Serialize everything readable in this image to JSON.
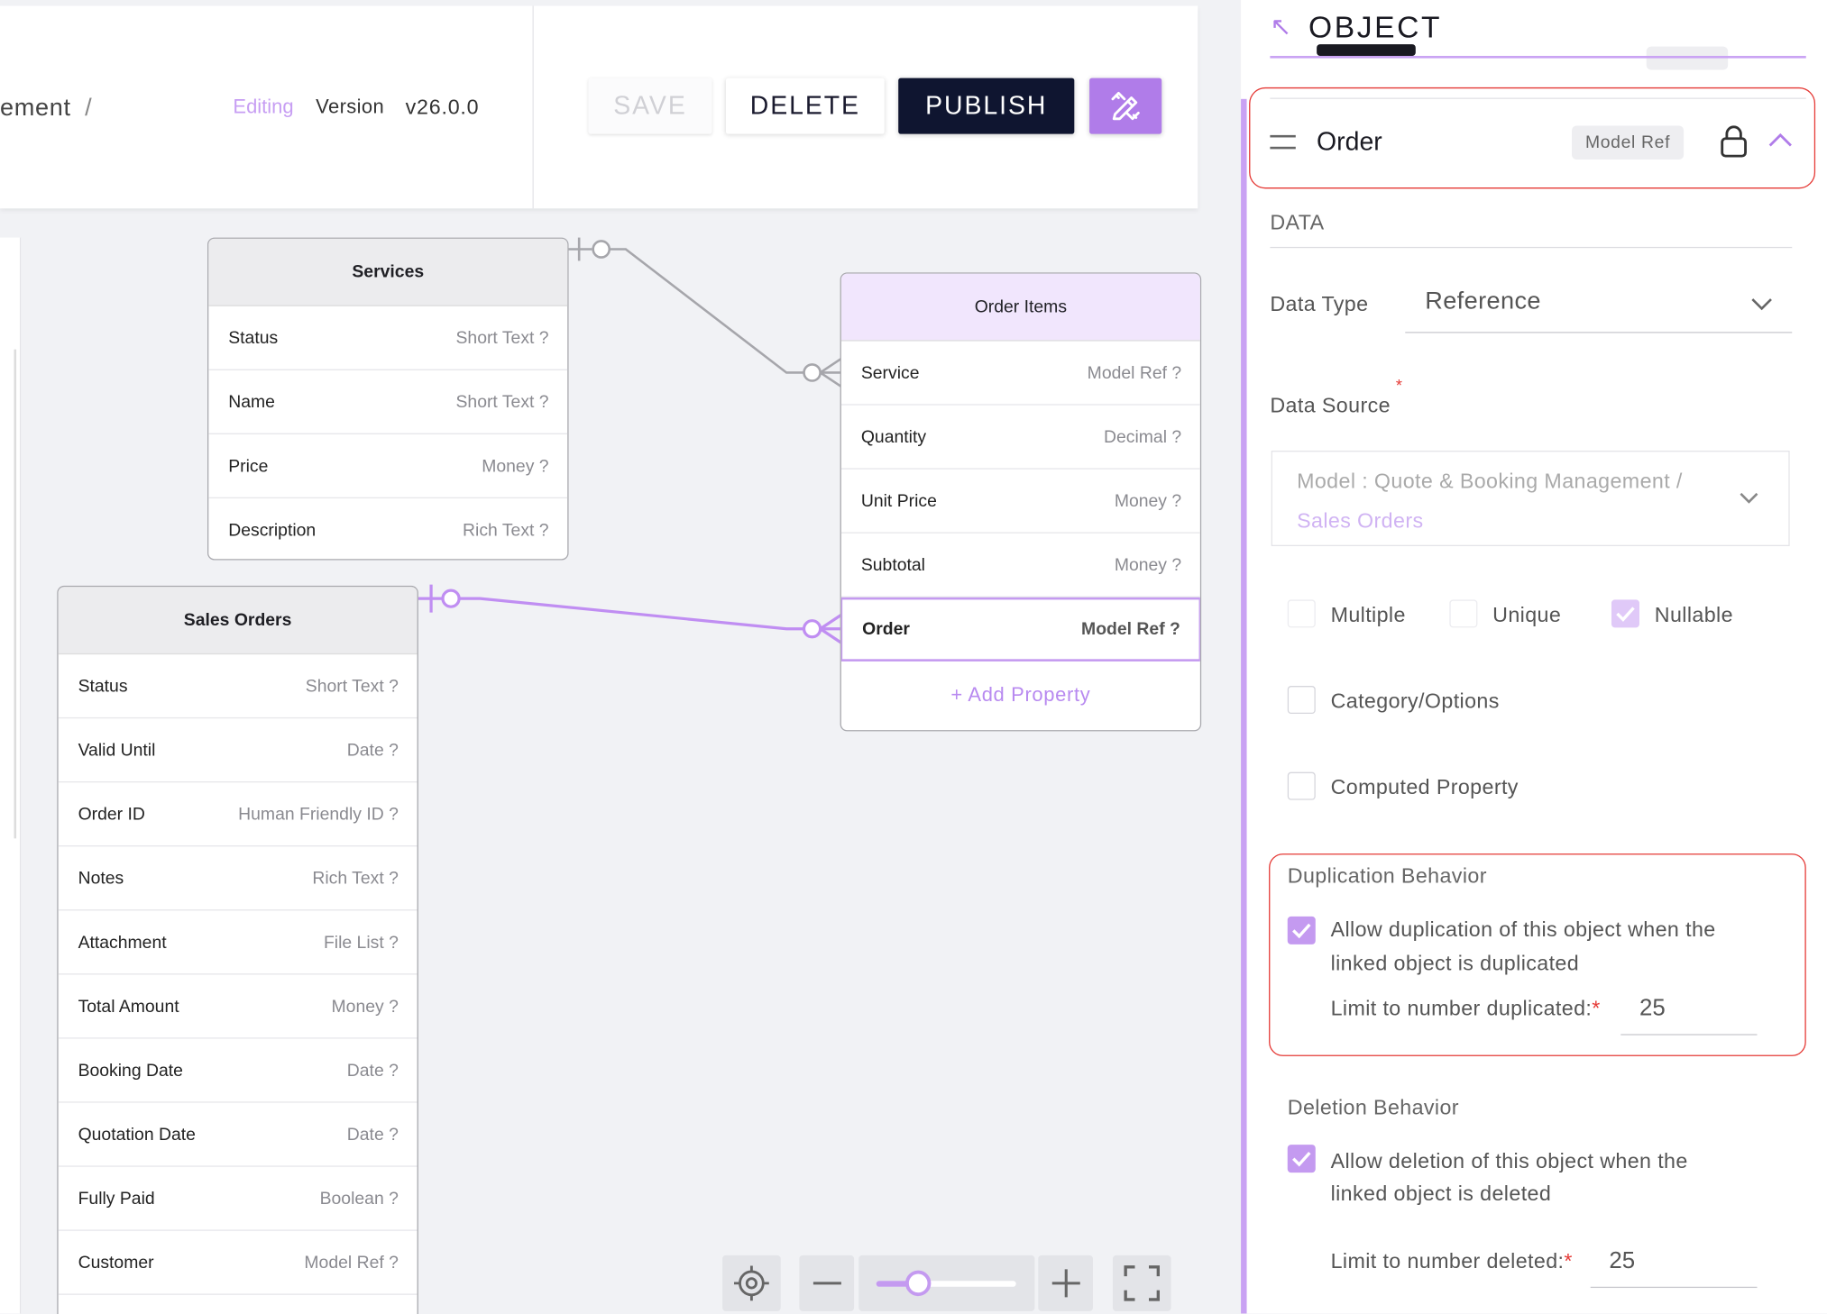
{
  "header": {
    "breadcrumb": "ement",
    "breadcrumb_sep": "/",
    "editing": "Editing",
    "version_label": "Version",
    "version_value": "v26.0.0",
    "save_label": "SAVE",
    "delete_label": "DELETE",
    "publish_label": "PUBLISH",
    "edit_icon": "pencil-ruler-icon"
  },
  "colors": {
    "accent": "#b07ce9",
    "publish": "#0f1530",
    "highlight": "#e53935"
  },
  "canvas": {
    "services": {
      "title": "Services",
      "rows": [
        {
          "name": "Status",
          "type": "Short Text ?"
        },
        {
          "name": "Name",
          "type": "Short Text ?"
        },
        {
          "name": "Price",
          "type": "Money ?"
        },
        {
          "name": "Description",
          "type": "Rich Text ?"
        }
      ]
    },
    "order_items": {
      "title": "Order Items",
      "rows": [
        {
          "name": "Service",
          "type": "Model Ref ?"
        },
        {
          "name": "Quantity",
          "type": "Decimal ?"
        },
        {
          "name": "Unit Price",
          "type": "Money ?"
        },
        {
          "name": "Subtotal",
          "type": "Money ?"
        },
        {
          "name": "Order",
          "type": "Model Ref ?"
        }
      ],
      "add_property": "+ Add Property"
    },
    "sales_orders": {
      "title": "Sales Orders",
      "rows": [
        {
          "name": "Status",
          "type": "Short Text ?"
        },
        {
          "name": "Valid Until",
          "type": "Date ?"
        },
        {
          "name": "Order ID",
          "type": "Human Friendly ID ?"
        },
        {
          "name": "Notes",
          "type": "Rich Text ?"
        },
        {
          "name": "Attachment",
          "type": "File List ?"
        },
        {
          "name": "Total Amount",
          "type": "Money ?"
        },
        {
          "name": "Booking Date",
          "type": "Date ?"
        },
        {
          "name": "Quotation Date",
          "type": "Date ?"
        },
        {
          "name": "Fully Paid",
          "type": "Boolean ?"
        },
        {
          "name": "Customer",
          "type": "Model Ref ?"
        }
      ]
    },
    "zoom": {
      "level": 0.3,
      "recenter_icon": "crosshair-icon",
      "minus_icon": "minus-icon",
      "plus_icon": "plus-icon",
      "fullscreen_icon": "fullscreen-icon"
    }
  },
  "panel": {
    "title": "OBJECT",
    "property_name": "Order",
    "property_badge": "Model Ref",
    "section_data": "DATA",
    "data_type_label": "Data Type",
    "data_type_value": "Reference",
    "data_source_label": "Data Source",
    "data_source_line1": "Model : Quote & Booking Management /",
    "data_source_line2": "Sales Orders",
    "required_mark": "*",
    "checkboxes": {
      "multiple": {
        "label": "Multiple",
        "checked": false
      },
      "unique": {
        "label": "Unique",
        "checked": false
      },
      "nullable": {
        "label": "Nullable",
        "checked": true
      },
      "category": {
        "label": "Category/Options",
        "checked": false
      },
      "computed": {
        "label": "Computed Property",
        "checked": false
      }
    },
    "duplication": {
      "title": "Duplication Behavior",
      "allow_line1": "Allow duplication of this object when the",
      "allow_line2": "linked object is duplicated",
      "allow_checked": true,
      "limit_label": "Limit to number duplicated:",
      "limit_value": "25"
    },
    "deletion": {
      "title": "Deletion Behavior",
      "allow_line1": "Allow deletion of this object when the",
      "allow_line2": "linked object is deleted",
      "allow_checked": true,
      "limit_label": "Limit to number deleted:",
      "limit_value": "25"
    }
  }
}
